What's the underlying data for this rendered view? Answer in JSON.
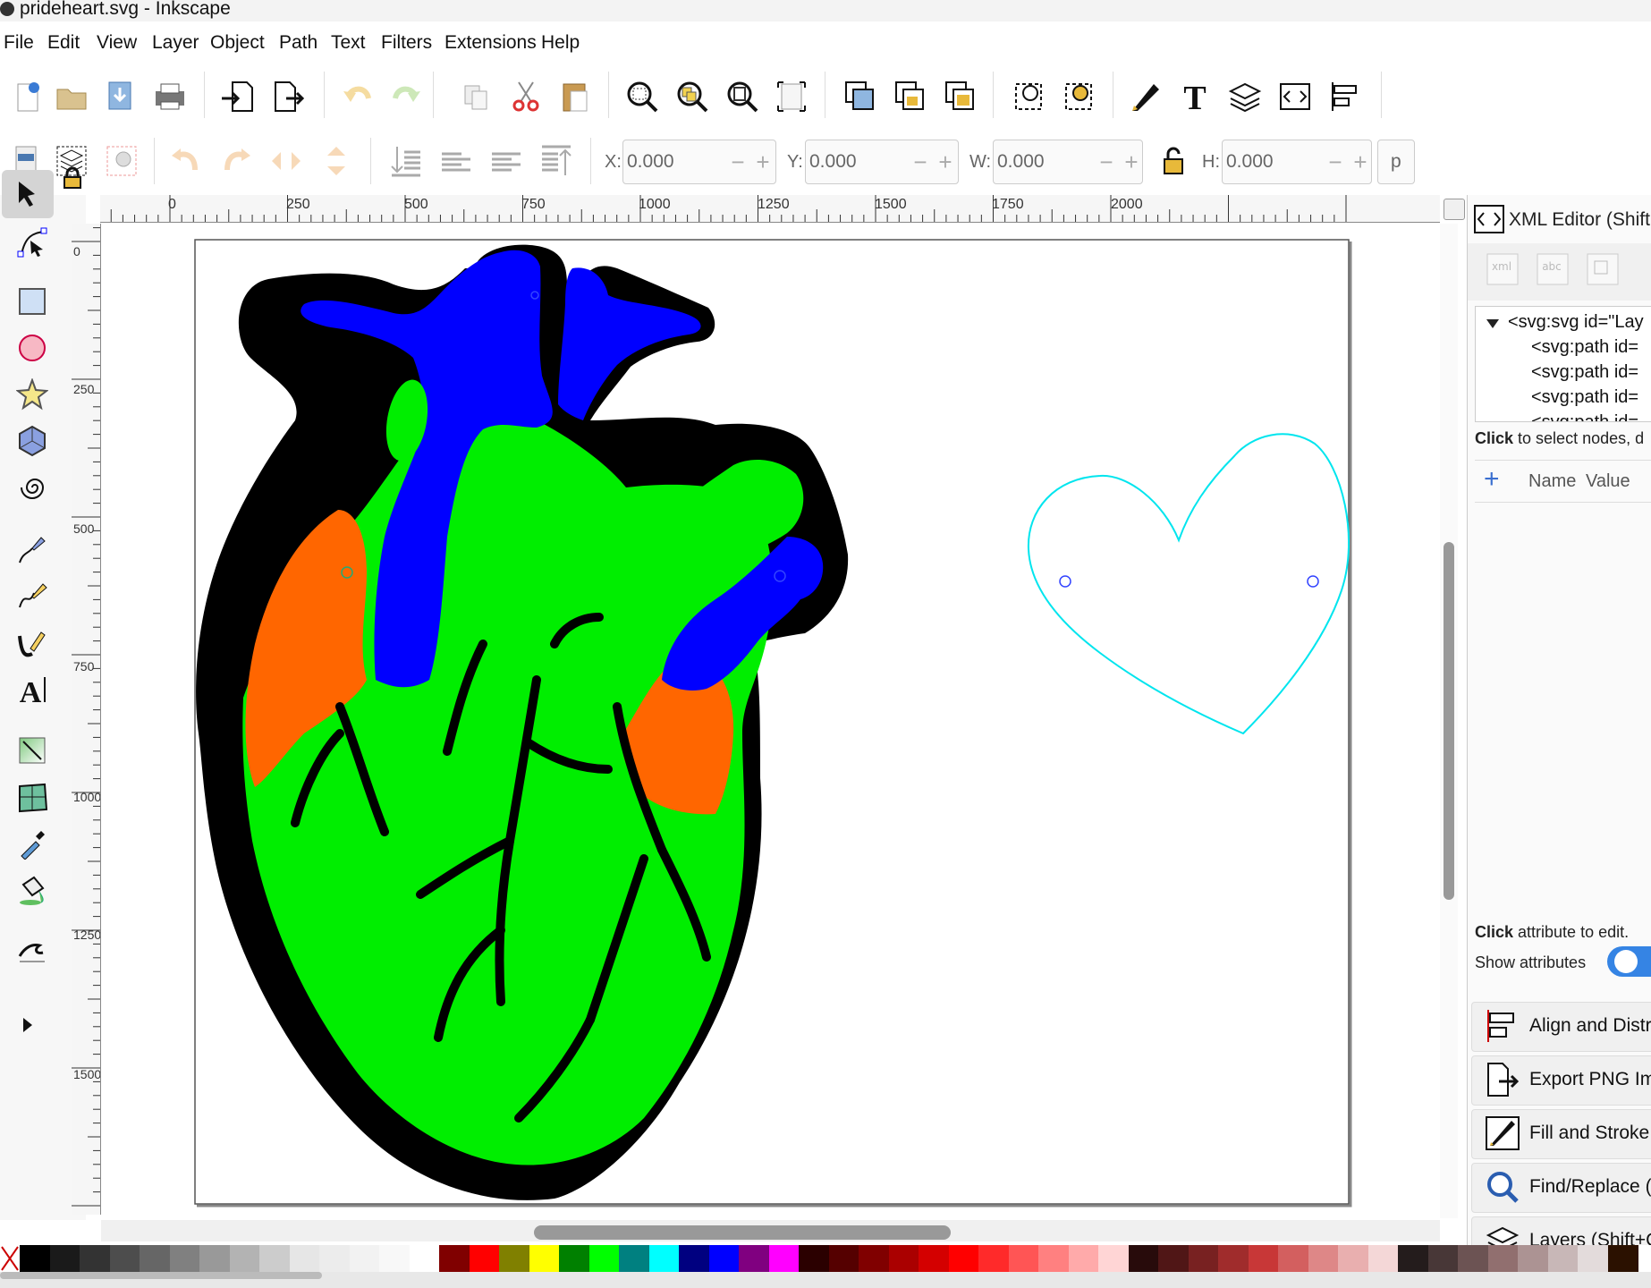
{
  "window": {
    "title": "prideheart.svg - Inkscape"
  },
  "menu": [
    "File",
    "Edit",
    "View",
    "Layer",
    "Object",
    "Path",
    "Text",
    "Filters",
    "Extensions",
    "Help"
  ],
  "toolbar_icons": [
    "new-document-icon",
    "open-folder-icon",
    "save-icon",
    "print-icon",
    "import-icon",
    "export-icon",
    "undo-icon",
    "redo-icon",
    "duplicate-icon",
    "cut-icon",
    "paste-icon",
    "zoom-selection-icon",
    "zoom-drawing-icon",
    "zoom-page-icon",
    "zoom-fit-icon",
    "group-icon",
    "lock-group-icon",
    "ungroup-icon",
    "clip-icon",
    "mask-icon",
    "fill-stroke-icon",
    "text-icon",
    "layers-icon",
    "xml-editor-icon",
    "align-icon"
  ],
  "transform": {
    "x_label": "X:",
    "x_value": "0.000",
    "y_label": "Y:",
    "y_value": "0.000",
    "w_label": "W:",
    "w_value": "0.000",
    "h_label": "H:",
    "h_value": "0.000",
    "unit_partial": "p"
  },
  "ruler": {
    "h_labels": [
      "0",
      "250",
      "500",
      "750",
      "1000",
      "1250",
      "1500",
      "1750",
      "2000"
    ],
    "v_labels": [
      "0",
      "250",
      "500",
      "750",
      "1000",
      "1250",
      "1500"
    ]
  },
  "canvas": {
    "heart_colors": {
      "outline": "#000000",
      "green": "#00ee00",
      "blue": "#0000ff",
      "orange": "#ff6600"
    },
    "selection_color": "#00ffff"
  },
  "xml_editor": {
    "title": "XML Editor (Shift+",
    "nodes": [
      "<svg:svg id=\"Lay",
      "<svg:path id=",
      "<svg:path id=",
      "<svg:path id=",
      "<svg:path id="
    ],
    "hint_nodes_bold": "Click",
    "hint_nodes": " to select nodes, d",
    "col_name": "Name",
    "col_value": "Value",
    "hint_attr_bold": "Click",
    "hint_attr": " attribute to edit.",
    "show_attributes": "Show attributes"
  },
  "docked_dialogs": [
    {
      "label": "Align and Distri",
      "icon": "align-icon"
    },
    {
      "label": "Export PNG Im",
      "icon": "export-png-icon"
    },
    {
      "label": "Fill and Stroke",
      "icon": "fill-stroke-icon"
    },
    {
      "label": "Find/Replace (",
      "icon": "find-icon"
    },
    {
      "label": "Layers (Shift+C",
      "icon": "layers-icon"
    }
  ],
  "palette": [
    "#000000",
    "#1a1a1a",
    "#333333",
    "#4d4d4d",
    "#666666",
    "#808080",
    "#999999",
    "#b3b3b3",
    "#cccccc",
    "#e6e6e6",
    "#ececec",
    "#f2f2f2",
    "#f8f8f8",
    "#ffffff",
    "#800000",
    "#ff0000",
    "#808000",
    "#ffff00",
    "#008000",
    "#00ff00",
    "#008080",
    "#00ffff",
    "#000080",
    "#0000ff",
    "#800080",
    "#ff00ff",
    "#2b0000",
    "#550000",
    "#800000",
    "#aa0000",
    "#d40000",
    "#ff0000",
    "#ff2a2a",
    "#ff5555",
    "#ff8080",
    "#ffaaaa",
    "#ffd5d5",
    "#280b0b",
    "#501616",
    "#782121",
    "#a02c2c",
    "#c83737",
    "#d35f5f",
    "#de8787",
    "#e9afaf",
    "#f4d7d7",
    "#241c1c",
    "#483737",
    "#6c5353",
    "#916f6f",
    "#ac9393",
    "#c8b7b7",
    "#e3dbdb",
    "#2b1100"
  ]
}
